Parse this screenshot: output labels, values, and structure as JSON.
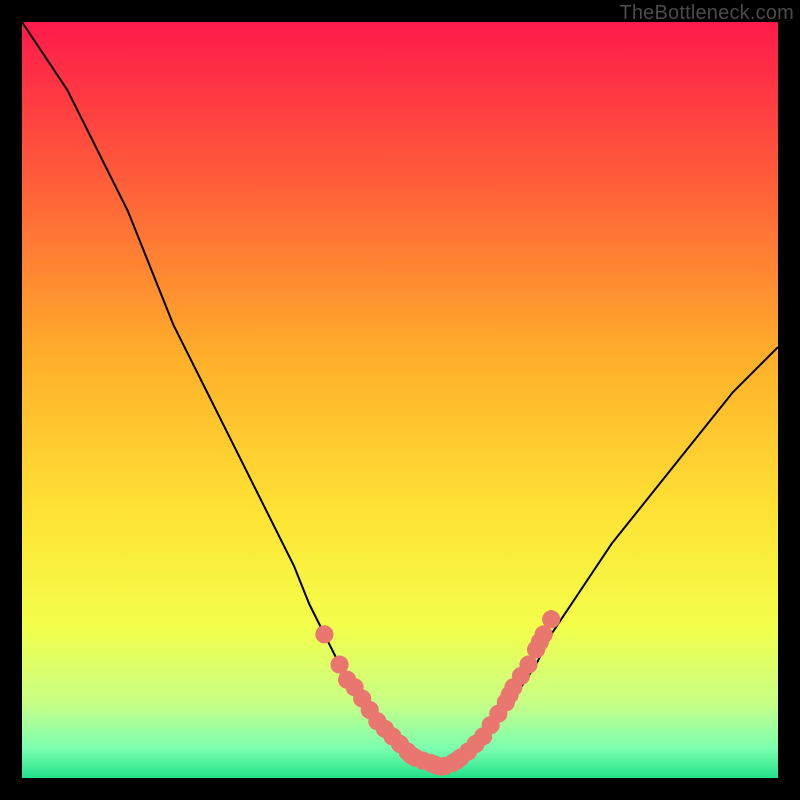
{
  "watermark": "TheBottleneck.com",
  "chart_data": {
    "type": "line",
    "title": "",
    "xlabel": "",
    "ylabel": "",
    "xlim": [
      0,
      100
    ],
    "ylim": [
      0,
      100
    ],
    "grid": false,
    "legend": false,
    "background_gradient": {
      "stops": [
        {
          "offset": 0.0,
          "color": "#ff1a4b"
        },
        {
          "offset": 0.2,
          "color": "#ff5a3a"
        },
        {
          "offset": 0.45,
          "color": "#ffb12a"
        },
        {
          "offset": 0.65,
          "color": "#ffe335"
        },
        {
          "offset": 0.8,
          "color": "#f3ff4a"
        },
        {
          "offset": 0.9,
          "color": "#c9ff86"
        },
        {
          "offset": 0.96,
          "color": "#7dffb0"
        },
        {
          "offset": 1.0,
          "color": "#22e28a"
        }
      ]
    },
    "series": [
      {
        "name": "bottleneck-curve",
        "color": "#000000",
        "x": [
          0,
          2,
          4,
          6,
          8,
          10,
          12,
          14,
          16,
          18,
          20,
          24,
          28,
          32,
          36,
          38,
          40,
          42,
          44,
          46,
          48,
          50,
          52,
          54,
          56,
          58,
          60,
          62,
          64,
          66,
          68,
          70,
          74,
          78,
          82,
          86,
          90,
          94,
          98,
          100
        ],
        "y": [
          100,
          97,
          94,
          91,
          87,
          83,
          79,
          75,
          70,
          65,
          60,
          52,
          44,
          36,
          28,
          23,
          19,
          15,
          12,
          9,
          6.5,
          4.5,
          3,
          2,
          1.5,
          2,
          3.5,
          6,
          9,
          12,
          15,
          19,
          25,
          31,
          36,
          41,
          46,
          51,
          55,
          57
        ]
      }
    ],
    "dots": {
      "color": "#e9766f",
      "radius": 1.2,
      "points": [
        {
          "x": 40,
          "y": 19
        },
        {
          "x": 42,
          "y": 15
        },
        {
          "x": 43,
          "y": 13
        },
        {
          "x": 44,
          "y": 12
        },
        {
          "x": 45,
          "y": 10.5
        },
        {
          "x": 46,
          "y": 9
        },
        {
          "x": 47,
          "y": 7.5
        },
        {
          "x": 48,
          "y": 6.5
        },
        {
          "x": 49,
          "y": 5.5
        },
        {
          "x": 50,
          "y": 4.5
        },
        {
          "x": 51,
          "y": 3.5
        },
        {
          "x": 51.5,
          "y": 3
        },
        {
          "x": 52,
          "y": 2.7
        },
        {
          "x": 53,
          "y": 2.3
        },
        {
          "x": 54,
          "y": 2
        },
        {
          "x": 54.5,
          "y": 1.8
        },
        {
          "x": 55,
          "y": 1.6
        },
        {
          "x": 55.5,
          "y": 1.5
        },
        {
          "x": 56,
          "y": 1.6
        },
        {
          "x": 57,
          "y": 2
        },
        {
          "x": 57.5,
          "y": 2.3
        },
        {
          "x": 58,
          "y": 2.7
        },
        {
          "x": 59,
          "y": 3.5
        },
        {
          "x": 60,
          "y": 4.5
        },
        {
          "x": 61,
          "y": 5.5
        },
        {
          "x": 62,
          "y": 7
        },
        {
          "x": 63,
          "y": 8.5
        },
        {
          "x": 64,
          "y": 10
        },
        {
          "x": 64.5,
          "y": 11
        },
        {
          "x": 65,
          "y": 12
        },
        {
          "x": 66,
          "y": 13.5
        },
        {
          "x": 67,
          "y": 15
        },
        {
          "x": 68,
          "y": 17
        },
        {
          "x": 68.5,
          "y": 18
        },
        {
          "x": 69,
          "y": 19
        },
        {
          "x": 70,
          "y": 21
        }
      ]
    }
  }
}
